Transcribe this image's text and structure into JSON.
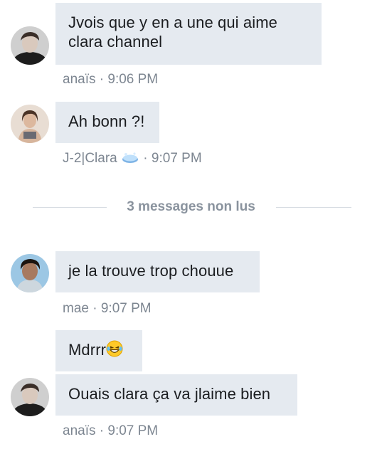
{
  "messages": [
    {
      "text_line1": "Jvois que y en a une qui aime",
      "text_line2": "clara channel",
      "author": "anaïs",
      "time": "9:06 PM",
      "separator": " · "
    },
    {
      "text": "Ah bonn ?!",
      "author": "J-2|Clara",
      "time": "9:07 PM",
      "separator": " · ",
      "badge": "soap-icon"
    },
    {
      "text": "je la trouve trop chouue",
      "author": "mae",
      "time": "9:07 PM",
      "separator": " · "
    },
    {
      "text": "Mdrrr",
      "emoji": "laughing-tears-emoji"
    },
    {
      "text": "Ouais clara ça va jlaime bien",
      "author": "anaïs",
      "time": "9:07 PM",
      "separator": " · "
    }
  ],
  "unread_separator": {
    "label": "3 messages non lus"
  },
  "colors": {
    "bubble": "#e5eaf0",
    "meta": "#7d8691",
    "separator_text": "#8a939e"
  }
}
